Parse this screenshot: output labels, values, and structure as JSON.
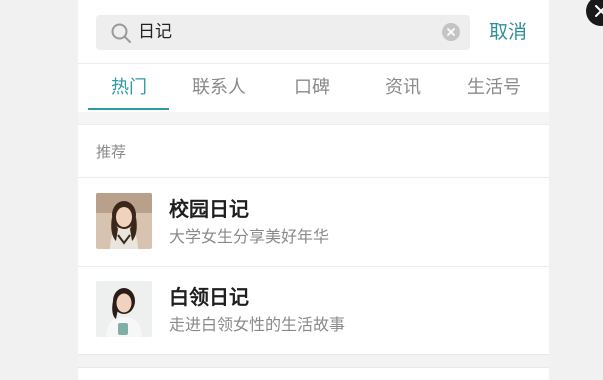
{
  "search": {
    "query": "日记",
    "cancel_label": "取消"
  },
  "tabs": [
    {
      "label": "热门"
    },
    {
      "label": "联系人"
    },
    {
      "label": "口碑"
    },
    {
      "label": "资讯"
    },
    {
      "label": "生活号"
    }
  ],
  "active_tab_index": 0,
  "section": {
    "label": "推荐"
  },
  "results": [
    {
      "title": "校园日记",
      "subtitle": "大学女生分享美好年华",
      "avatar_icon": "female-student-photo"
    },
    {
      "title": "白领日记",
      "subtitle": "走进白领女性的生活故事",
      "avatar_icon": "office-woman-photo"
    }
  ],
  "colors": {
    "accent": "#2f9aa5",
    "background": "#f1f1f1",
    "panel": "#ffffff"
  }
}
